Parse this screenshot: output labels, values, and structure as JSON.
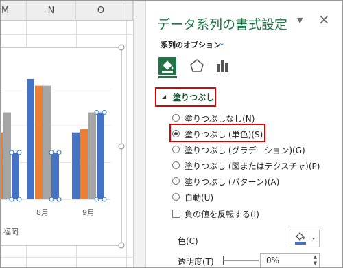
{
  "spreadsheet": {
    "columns": [
      {
        "label": "M"
      },
      {
        "label": "N"
      },
      {
        "label": "O"
      }
    ]
  },
  "chart_data": {
    "type": "bar",
    "categories": [
      "",
      "8月",
      "9月"
    ],
    "series": [
      {
        "values": [
          10,
          18,
          10
        ],
        "color": "#4472c4"
      },
      {
        "values": [
          10,
          17,
          10.5
        ],
        "color": "#ed7d31"
      },
      {
        "values": [
          13,
          17,
          13
        ],
        "color": "#a5a5a5"
      },
      {
        "values": [
          7,
          7,
          13
        ],
        "color": "#4472c4"
      }
    ],
    "legend_text": "福岡",
    "ylim": [
      0,
      22
    ],
    "grid": true
  },
  "pane": {
    "title": "データ系列の書式設定",
    "title_dropdown": "▼",
    "close": "×",
    "series_options": "系列のオプション",
    "series_options_dropdown": "⌄",
    "section_caret": "◢",
    "section": "塗りつぶし",
    "fill_options": [
      {
        "label": "塗りつぶしなし(N)",
        "selected": false
      },
      {
        "label": "塗りつぶし (単色)(S)",
        "selected": true
      },
      {
        "label": "塗りつぶし (グラデーション)(G)",
        "selected": false
      },
      {
        "label": "塗りつぶし (図またはテクスチャ)(P)",
        "selected": false
      },
      {
        "label": "塗りつぶし (パターン)(A)",
        "selected": false
      },
      {
        "label": "自動(U)",
        "selected": false
      }
    ],
    "invert_label": "負の値を反転する(I)",
    "color_label": "色(C)",
    "color_swatch": "#4472c4",
    "transparency_label": "透明度(T)",
    "transparency_value": "0%",
    "accent_color": "#217346",
    "highlight_color": "#e00000"
  }
}
